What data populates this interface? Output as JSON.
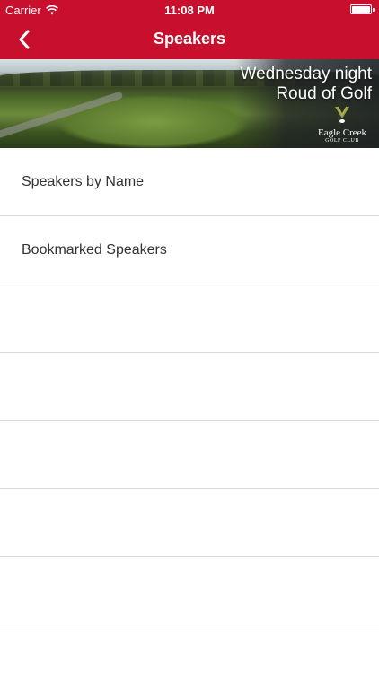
{
  "status_bar": {
    "carrier": "Carrier",
    "time": "11:08 PM",
    "battery_level": 1.0,
    "icons": [
      "wifi-icon",
      "battery-icon"
    ]
  },
  "nav": {
    "title": "Speakers",
    "back_icon": "chevron-left-icon"
  },
  "banner": {
    "line1": "Wednesday night",
    "line2": "Roud of Golf",
    "logo_word": "Eagle Creek",
    "logo_sub": "GOLF CLUB"
  },
  "list": {
    "items": [
      {
        "label": "Speakers by Name"
      },
      {
        "label": "Bookmarked Speakers"
      },
      {
        "label": ""
      },
      {
        "label": ""
      },
      {
        "label": ""
      },
      {
        "label": ""
      },
      {
        "label": ""
      }
    ]
  },
  "colors": {
    "brand_red": "#c8102e",
    "text": "#333333",
    "separator": "#d9d9d9"
  }
}
